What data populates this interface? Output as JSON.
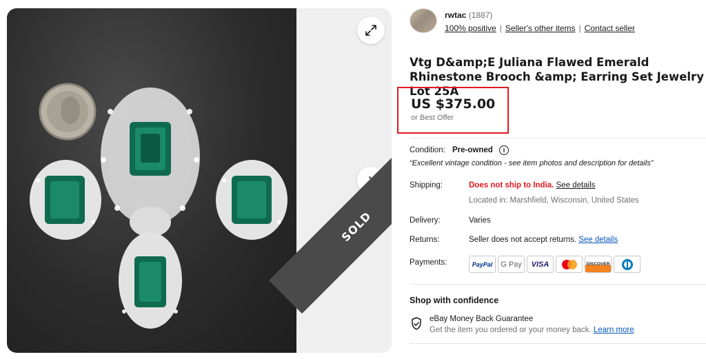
{
  "gallery": {
    "sold_label": "SOLD",
    "image_alt": "Vintage emerald rhinestone brooch and earrings next to a coin",
    "expand_icon": "expand-icon",
    "next_icon": "chevron-right-icon"
  },
  "seller": {
    "name": "rwtac",
    "count": "(1887)",
    "positive": "100% positive",
    "other_items": "Seller's other items",
    "contact": "Contact seller"
  },
  "listing": {
    "title": "Vtg D&amp;E Juliana Flawed Emerald Rhinestone Brooch &amp; Earring Set Jewelry Lot 25A",
    "price": "US $375.00",
    "best_offer": "or Best Offer"
  },
  "condition": {
    "label": "Condition:",
    "value": "Pre-owned",
    "quote": "“Excellent vintage condition - see item photos and description for details”"
  },
  "shipping": {
    "label": "Shipping:",
    "warning": "Does not ship to India.",
    "details_link": "See details",
    "location": "Located in: Marshfield, Wisconsin, United States"
  },
  "delivery": {
    "label": "Delivery:",
    "value": "Varies"
  },
  "returns": {
    "label": "Returns:",
    "value": "Seller does not accept returns.",
    "details_link": "See details"
  },
  "payments": {
    "label": "Payments:",
    "methods": [
      "PayPal",
      "G Pay",
      "VISA",
      "Mastercard",
      "DISCOVER",
      "Diners Club"
    ]
  },
  "confidence": {
    "title": "Shop with confidence",
    "guarantee_title": "eBay Money Back Guarantee",
    "guarantee_text": "Get the item you ordered or your money back.",
    "learn_more": "Learn more"
  },
  "colors": {
    "highlight_border": "#e0191f",
    "link_blue": "#0654ba",
    "warning_red": "#e0191f"
  }
}
